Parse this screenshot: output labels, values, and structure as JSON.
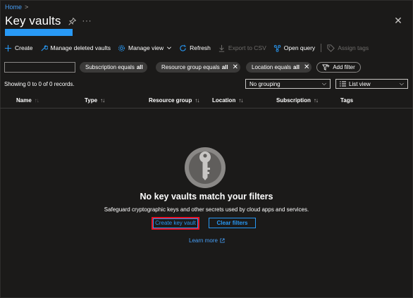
{
  "breadcrumb": {
    "home": "Home",
    "separator": ">"
  },
  "header": {
    "title": "Key vaults",
    "more": "···",
    "close": "✕"
  },
  "toolbar": {
    "create": "Create",
    "manage_deleted": "Manage deleted vaults",
    "manage_view": "Manage view",
    "refresh": "Refresh",
    "export_csv": "Export to CSV",
    "open_query": "Open query",
    "assign_tags": "Assign tags"
  },
  "filters": {
    "search_value": "",
    "subscription": {
      "label": "Subscription equals",
      "value": "all"
    },
    "resource_group": {
      "label": "Resource group equals",
      "value": "all"
    },
    "location": {
      "label": "Location equals",
      "value": "all"
    },
    "add_filter": "Add filter"
  },
  "status": {
    "records": "Showing 0 to 0 of 0 records.",
    "grouping": "No grouping",
    "view": "List view"
  },
  "table": {
    "columns": [
      "Name",
      "Type",
      "Resource group",
      "Location",
      "Subscription",
      "Tags"
    ]
  },
  "empty_state": {
    "title": "No key vaults match your filters",
    "description": "Safeguard cryptographic keys and other secrets used by cloud apps and services.",
    "create_button": "Create key vault",
    "clear_button": "Clear filters",
    "learn_more": "Learn more"
  },
  "colors": {
    "background": "#1b1a19",
    "accent": "#2899f5",
    "link": "#479ef5",
    "highlight_border": "#e81123",
    "pill": "#3b3a39"
  }
}
